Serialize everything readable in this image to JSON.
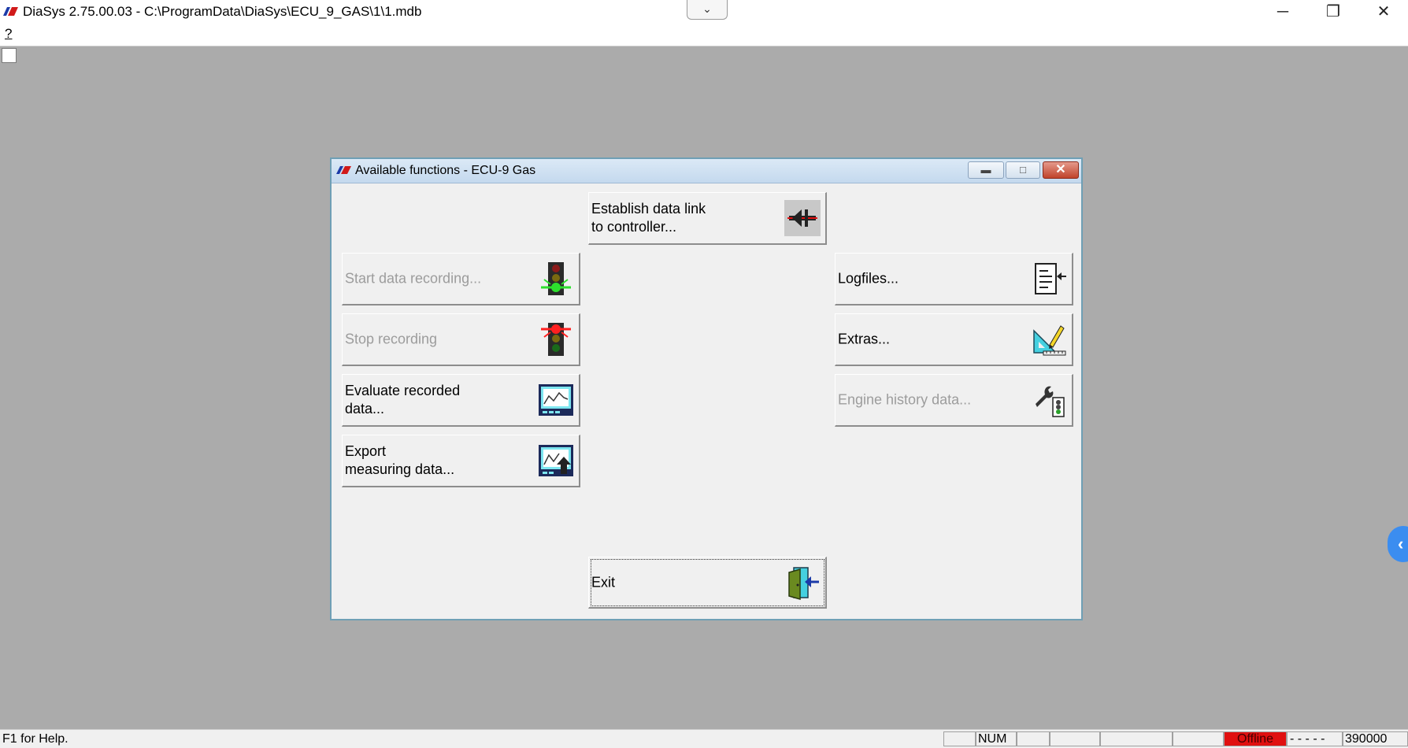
{
  "window": {
    "title": "DiaSys 2.75.00.03 - C:\\ProgramData\\DiaSys\\ECU_9_GAS\\1\\1.mdb",
    "dropdown_glyph": "⌄",
    "minimize_glyph": "─",
    "restore_glyph": "❐",
    "close_glyph": "✕"
  },
  "menu": {
    "help": "?"
  },
  "dialog": {
    "title": "Available functions - ECU-9 Gas",
    "min_glyph": "▬",
    "max_glyph": "□",
    "close_glyph": "✕"
  },
  "buttons": {
    "establish": {
      "label": "Establish data link\nto controller...",
      "icon": "plug-connect-icon"
    },
    "start_recording": {
      "label": "Start data recording...",
      "icon": "traffic-light-green-icon",
      "disabled": true
    },
    "stop_recording": {
      "label": "Stop recording",
      "icon": "traffic-light-red-icon",
      "disabled": true
    },
    "evaluate": {
      "label": "Evaluate recorded\ndata...",
      "icon": "chart-monitor-icon"
    },
    "export": {
      "label": "Export\nmeasuring data...",
      "icon": "chart-export-icon"
    },
    "logfiles": {
      "label": "Logfiles...",
      "icon": "logfile-icon"
    },
    "extras": {
      "label": "Extras...",
      "icon": "triangle-ruler-pencil-icon"
    },
    "engine_history": {
      "label": "Engine history data...",
      "icon": "wrench-traffic-icon",
      "disabled": true
    },
    "exit": {
      "label": "Exit",
      "icon": "exit-door-icon"
    }
  },
  "status": {
    "help_text": "F1 for Help.",
    "num": "NUM",
    "offline": "Offline",
    "dashes": "- - - - -",
    "baud": "390000"
  },
  "colors": {
    "desktop": "#ababab",
    "offline": "#e01010",
    "accent": "#3b8df0"
  }
}
